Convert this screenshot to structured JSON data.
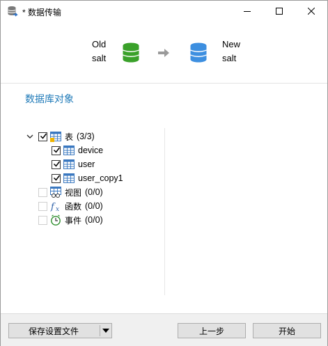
{
  "window": {
    "title": "* 数据传输"
  },
  "header": {
    "source": {
      "line1": "Old",
      "line2": "salt"
    },
    "target": {
      "line1": "New",
      "line2": "salt"
    }
  },
  "section": {
    "title": "数据库对象"
  },
  "tree": {
    "tables": {
      "label": "表",
      "count": "(3/3)",
      "items": [
        "device",
        "user",
        "user_copy1"
      ]
    },
    "views": {
      "label": "视图",
      "count": "(0/0)"
    },
    "functions": {
      "label": "函数",
      "count": "(0/0)"
    },
    "events": {
      "label": "事件",
      "count": "(0/0)"
    }
  },
  "footer": {
    "save_profile": "保存设置文件",
    "back": "上一步",
    "start": "开始"
  },
  "colors": {
    "source_db": "#3aa12a",
    "target_db": "#3d8fe0",
    "accent": "#1f7ab8"
  }
}
